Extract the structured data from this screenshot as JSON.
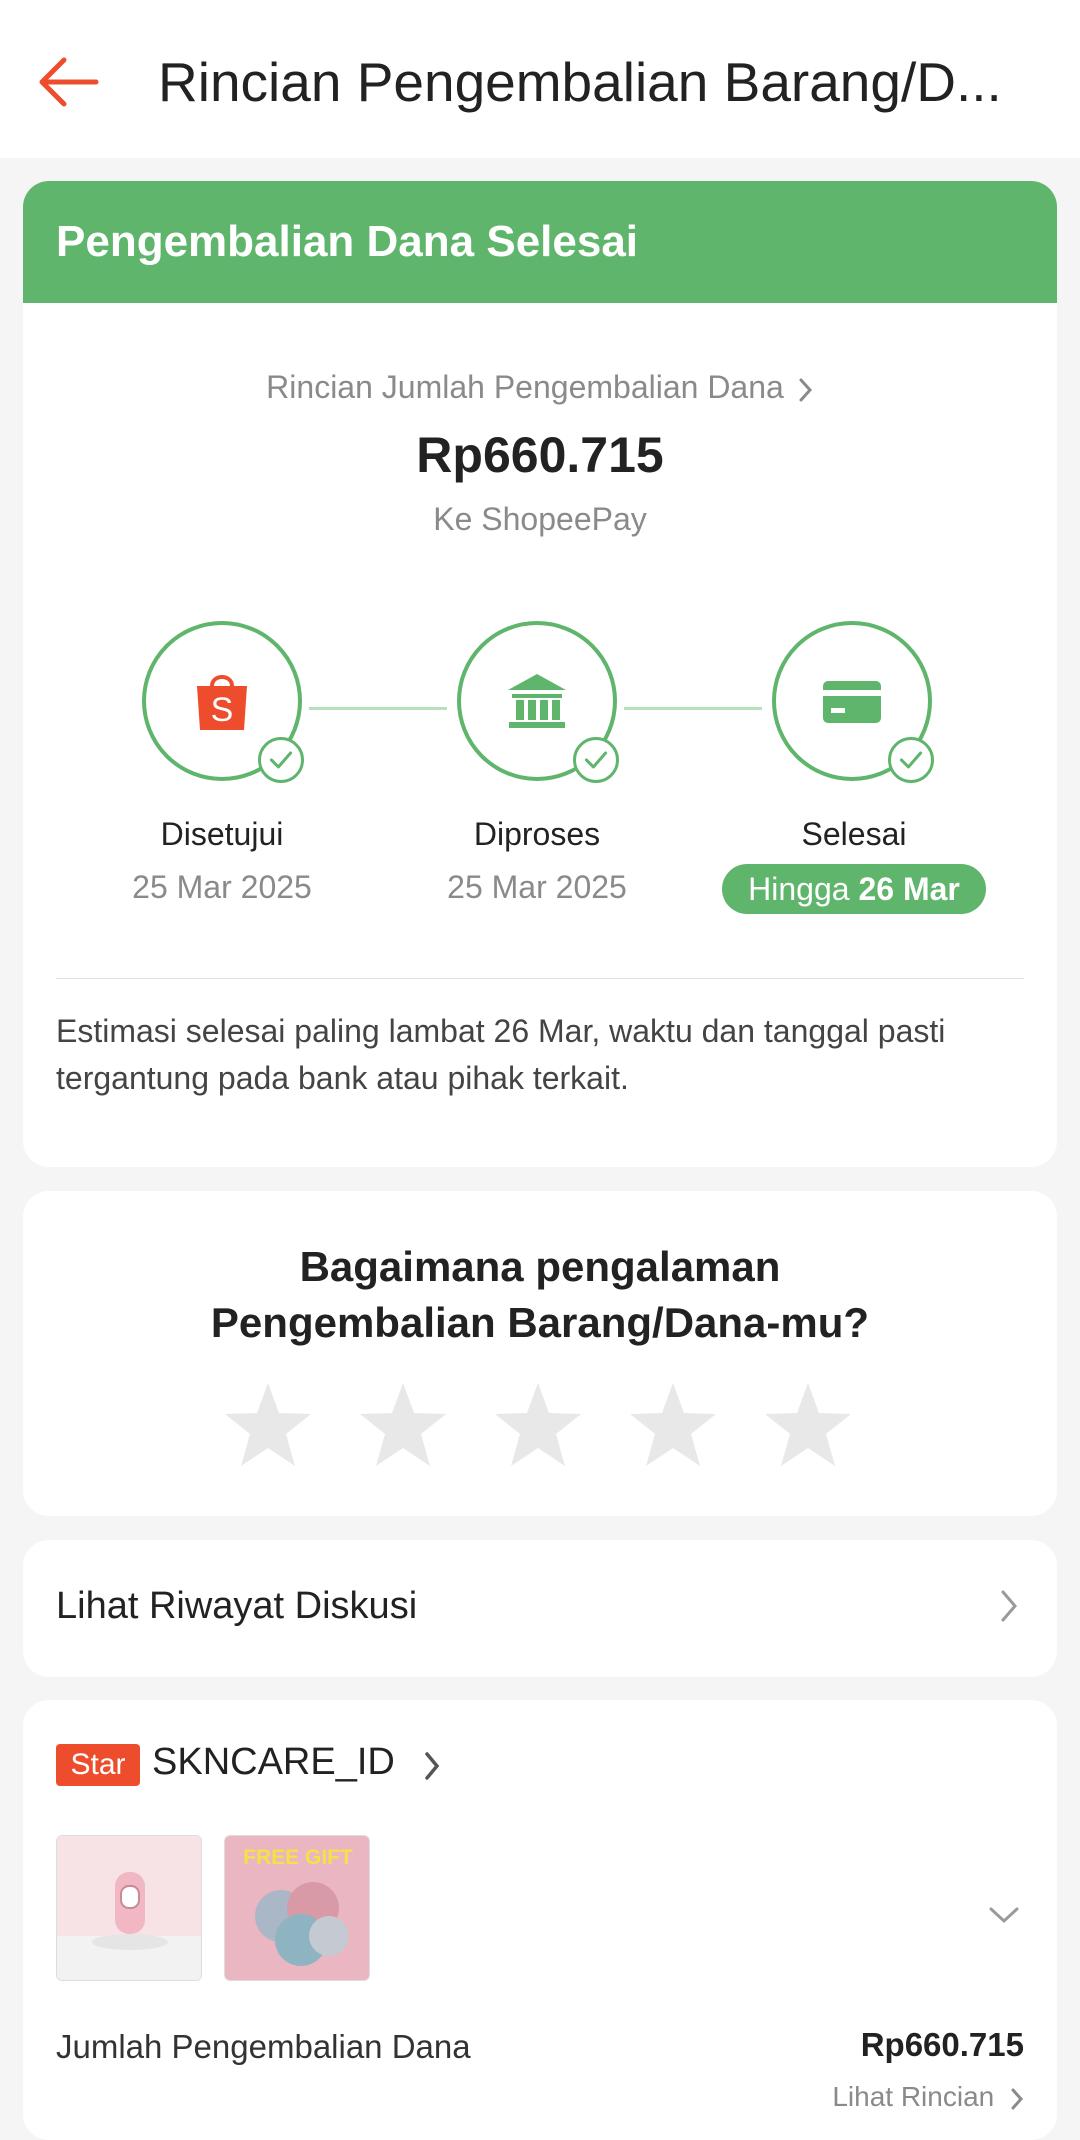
{
  "header": {
    "title": "Rincian Pengembalian Barang/D..."
  },
  "status": {
    "banner": "Pengembalian Dana Selesai",
    "detail_link": "Rincian Jumlah Pengembalian Dana",
    "amount": "Rp660.715",
    "destination": "Ke ShopeePay",
    "steps": [
      {
        "label": "Disetujui",
        "date": "25 Mar 2025",
        "icon": "shopee-bag-icon"
      },
      {
        "label": "Diproses",
        "date": "25 Mar 2025",
        "icon": "bank-icon"
      },
      {
        "label": "Selesai",
        "pill_prefix": "Hingga",
        "pill_date": "26 Mar",
        "icon": "card-icon"
      }
    ],
    "note": "Estimasi selesai paling lambat 26 Mar, waktu dan tanggal pasti tergantung pada bank atau pihak terkait."
  },
  "rating": {
    "question": "Bagaimana pengalaman Pengembalian Barang/Dana-mu?",
    "stars": 5,
    "selected": 0
  },
  "discussion": {
    "label": "Lihat Riwayat Diskusi"
  },
  "shop": {
    "badge": "Star",
    "name": "SKNCARE_ID",
    "thumb_gift_text": "FREE GIFT",
    "refund_label": "Jumlah Pengembalian Dana",
    "refund_amount": "Rp660.715",
    "see_detail": "Lihat Rincian"
  },
  "colors": {
    "accent": "#ee4d2d",
    "success": "#5fb56c"
  }
}
